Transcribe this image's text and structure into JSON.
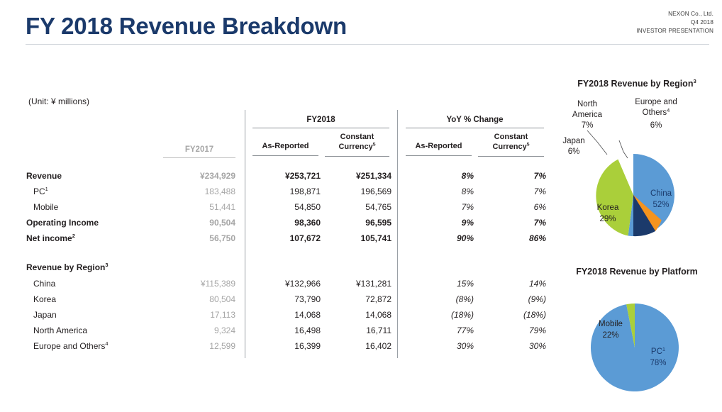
{
  "header": {
    "title": "FY 2018 Revenue Breakdown",
    "company": "NEXON Co., Ltd.",
    "quarter": "Q4 2018",
    "doc_type": "INVESTOR PRESENTATION",
    "title_color": "#1b3a6b"
  },
  "table": {
    "unit_note": "(Unit: ¥ millions)",
    "group_headers": {
      "fy2018": "FY2018",
      "yoy": "YoY % Change"
    },
    "sub_headers": {
      "fy2018_as_reported": "As-Reported",
      "fy2018_constant_currency": "Constant Currency",
      "fy2018_constant_currency_sup": "5",
      "yoy_as_reported": "As-Reported",
      "yoy_constant_currency": "Constant Currency",
      "yoy_constant_currency_sup": "5"
    },
    "fy2017_header": "FY2017",
    "rows": [
      {
        "label": "Revenue",
        "sup": "",
        "bold": true,
        "indent": false,
        "fy2017": "¥234,929",
        "ar18": "¥253,721",
        "cc18": "¥251,334",
        "aryoy": "8%",
        "ccyoy": "7%"
      },
      {
        "label": "PC",
        "sup": "1",
        "bold": false,
        "indent": true,
        "fy2017": "183,488",
        "ar18": "198,871",
        "cc18": "196,569",
        "aryoy": "8%",
        "ccyoy": "7%"
      },
      {
        "label": "Mobile",
        "sup": "",
        "bold": false,
        "indent": true,
        "fy2017": "51,441",
        "ar18": "54,850",
        "cc18": "54,765",
        "aryoy": "7%",
        "ccyoy": "6%"
      },
      {
        "label": "Operating Income",
        "sup": "",
        "bold": true,
        "indent": false,
        "fy2017": "90,504",
        "ar18": "98,360",
        "cc18": "96,595",
        "aryoy": "9%",
        "ccyoy": "7%"
      },
      {
        "label": "Net income",
        "sup": "2",
        "bold": true,
        "indent": false,
        "fy2017": "56,750",
        "ar18": "107,672",
        "cc18": "105,741",
        "aryoy": "90%",
        "ccyoy": "86%"
      }
    ],
    "region_section_label": "Revenue by Region",
    "region_section_sup": "3",
    "region_rows": [
      {
        "label": "China",
        "sup": "",
        "bold": false,
        "indent": true,
        "fy2017": "¥115,389",
        "ar18": "¥132,966",
        "cc18": "¥131,281",
        "aryoy": "15%",
        "ccyoy": "14%"
      },
      {
        "label": "Korea",
        "sup": "",
        "bold": false,
        "indent": true,
        "fy2017": "80,504",
        "ar18": "73,790",
        "cc18": "72,872",
        "aryoy": "(8%)",
        "ccyoy": "(9%)"
      },
      {
        "label": "Japan",
        "sup": "",
        "bold": false,
        "indent": true,
        "fy2017": "17,113",
        "ar18": "14,068",
        "cc18": "14,068",
        "aryoy": "(18%)",
        "ccyoy": "(18%)"
      },
      {
        "label": "North America",
        "sup": "",
        "bold": false,
        "indent": true,
        "fy2017": "9,324",
        "ar18": "16,498",
        "cc18": "16,711",
        "aryoy": "77%",
        "ccyoy": "79%"
      },
      {
        "label": "Europe and Others",
        "sup": "4",
        "bold": false,
        "indent": true,
        "fy2017": "12,599",
        "ar18": "16,399",
        "cc18": "16,402",
        "aryoy": "30%",
        "ccyoy": "30%"
      }
    ]
  },
  "chart_data": [
    {
      "type": "pie",
      "title": "FY2018 Revenue by Region",
      "title_sup": "3",
      "categories": [
        "China",
        "Korea",
        "Japan",
        "North America",
        "Europe and Others"
      ],
      "values": [
        52,
        29,
        6,
        7,
        6
      ],
      "value_labels": [
        "52%",
        "29%",
        "6%",
        "7%",
        "6%"
      ],
      "colors": [
        "#5b9bd5",
        "#aacf3a",
        "#e8565a",
        "#f5941e",
        "#1b3a6b"
      ],
      "category_sups": [
        "",
        "",
        "",
        "",
        "4"
      ],
      "legend": "labels-on-slices",
      "start_angle_deg": 0,
      "direction": "clockwise"
    },
    {
      "type": "pie",
      "title": "FY2018 Revenue by Platform",
      "title_sup": "",
      "categories": [
        "PC",
        "Mobile"
      ],
      "values": [
        78,
        22
      ],
      "value_labels": [
        "78%",
        "22%"
      ],
      "colors": [
        "#5b9bd5",
        "#aacf3a"
      ],
      "category_sups": [
        "1",
        ""
      ],
      "legend": "labels-on-slices",
      "start_angle_deg": 0,
      "direction": "clockwise"
    }
  ]
}
